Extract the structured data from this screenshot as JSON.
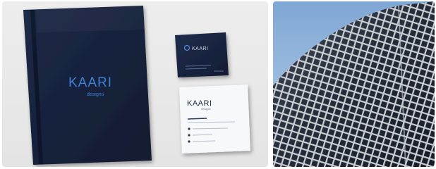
{
  "gallery": {
    "tiles": [
      {
        "kind": "branding-mockup",
        "folder": {
          "brand_name": "KAARI",
          "brand_sub": "designs"
        },
        "card_dark": {
          "brand_name": "KAARI"
        },
        "card_light": {
          "brand_name": "KAARI",
          "brand_sub": "designs"
        }
      },
      {
        "kind": "architecture-photo"
      }
    ]
  },
  "colors": {
    "navy": "#17233d",
    "navy_light": "#22325a",
    "brand_blue": "#3f7fd6",
    "sky": "#8fb3d9",
    "facade": "#2b3442"
  }
}
